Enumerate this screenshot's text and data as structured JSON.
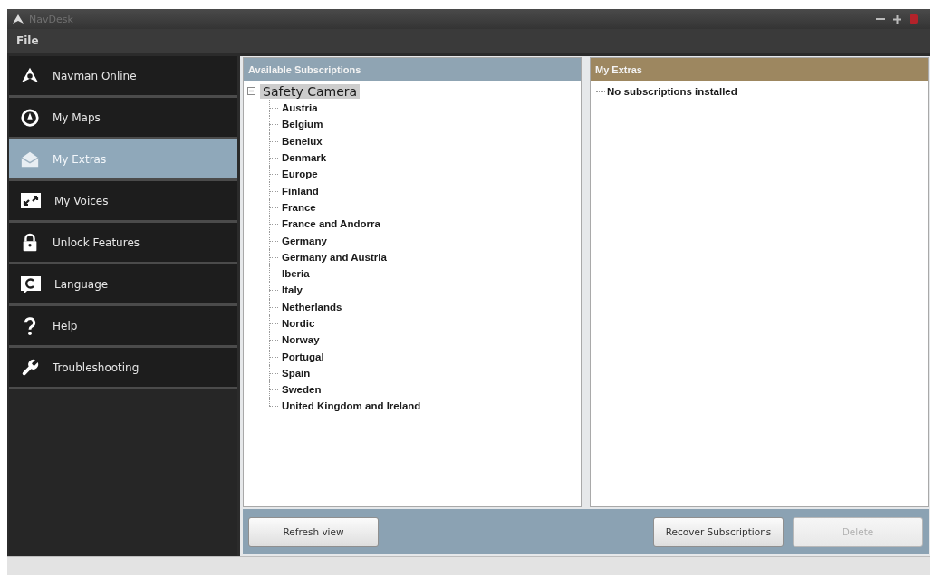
{
  "window": {
    "title": "NavDesk"
  },
  "menu": [
    {
      "label": "File"
    }
  ],
  "sidebar": {
    "items": [
      {
        "label": "Navman Online",
        "selected": false
      },
      {
        "label": "My Maps",
        "selected": false
      },
      {
        "label": "My Extras",
        "selected": true
      },
      {
        "label": "My Voices",
        "selected": false
      },
      {
        "label": "Unlock Features",
        "selected": false
      },
      {
        "label": "Language",
        "selected": false
      },
      {
        "label": "Help",
        "selected": false
      },
      {
        "label": "Troubleshooting",
        "selected": false
      }
    ]
  },
  "available_subscriptions": {
    "title": "Available Subscriptions",
    "tree": [
      {
        "label": "Safety Camera",
        "expanded": true,
        "selected": true,
        "children": [
          {
            "label": "Austria"
          },
          {
            "label": "Belgium"
          },
          {
            "label": "Benelux"
          },
          {
            "label": "Denmark"
          },
          {
            "label": "Europe"
          },
          {
            "label": "Finland"
          },
          {
            "label": "France"
          },
          {
            "label": "France and Andorra"
          },
          {
            "label": "Germany"
          },
          {
            "label": "Germany and Austria"
          },
          {
            "label": "Iberia"
          },
          {
            "label": "Italy"
          },
          {
            "label": "Netherlands"
          },
          {
            "label": "Nordic"
          },
          {
            "label": "Norway"
          },
          {
            "label": "Portugal"
          },
          {
            "label": "Spain"
          },
          {
            "label": "Sweden"
          },
          {
            "label": "United Kingdom and Ireland"
          }
        ]
      }
    ]
  },
  "my_extras": {
    "title": "My Extras",
    "items": [
      {
        "label": "No subscriptions installed"
      }
    ]
  },
  "buttons": [
    {
      "label": "Refresh view",
      "disabled": false
    },
    {
      "label": "Recover Subscriptions",
      "disabled": false
    },
    {
      "label": "Delete",
      "disabled": true
    }
  ]
}
